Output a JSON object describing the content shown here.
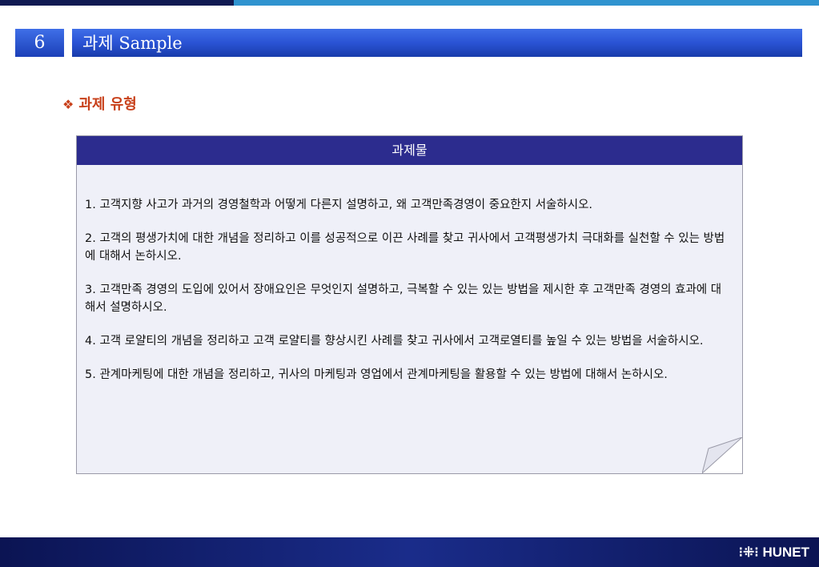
{
  "header": {
    "section_number": "6",
    "title": "과제 Sample"
  },
  "subheading": "과제 유형",
  "note": {
    "header": "과제물",
    "items": [
      "1. 고객지향 사고가 과거의 경영철학과 어떻게 다른지 설명하고, 왜 고객만족경영이 중요한지 서술하시오.",
      "2. 고객의 평생가치에 대한 개념을 정리하고 이를 성공적으로 이끈 사례를 찾고 귀사에서 고객평생가치 극대화를 실천할 수 있는 방법에 대해서 논하시오.",
      "3. 고객만족 경영의 도입에 있어서 장애요인은 무엇인지 설명하고, 극복할 수 있는 있는 방법을 제시한 후 고객만족 경영의 효과에 대해서 설명하시오.",
      "4. 고객 로얄티의 개념을 정리하고 고객 로얄티를 향상시킨 사례를 찾고 귀사에서 고객로열티를 높일 수 있는 방법을 서술하시오.",
      "5. 관계마케팅에 대한 개념을 정리하고, 귀사의 마케팅과 영업에서 관계마케팅을 활용할 수 있는 방법에 대해서 논하시오."
    ]
  },
  "footer": {
    "logo": "HUNET"
  },
  "colors": {
    "title_bar": "#2a53d4",
    "note_header": "#2c2c8e",
    "note_background": "#eff0f8",
    "subheading": "#c8401a",
    "footer": "#0b1453"
  }
}
